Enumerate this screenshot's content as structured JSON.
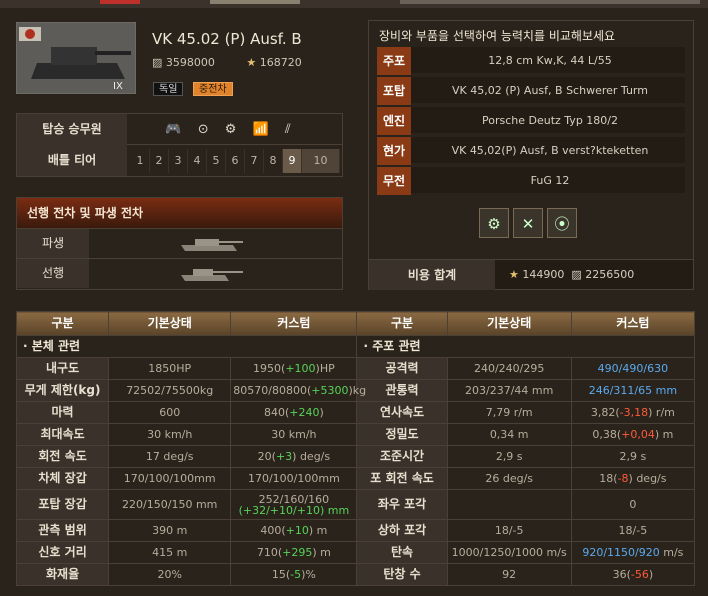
{
  "tank": {
    "name": "VK 45.02 (P) Ausf. B",
    "silver": "3598000",
    "gold": "168720",
    "tier_label": "IX",
    "badge_nation": "독일",
    "badge_class": "중전차"
  },
  "crew": {
    "label": "탑승 승무원",
    "icons": "🎮 ⊙ ⚙ 📶 ⫽"
  },
  "tiers": {
    "label": "배틀 티어",
    "values": [
      "1",
      "2",
      "3",
      "4",
      "5",
      "6",
      "7",
      "8",
      "9",
      "10"
    ]
  },
  "related": {
    "title": "선행 전차 및 파생 전차",
    "derived": "파생",
    "previous": "선행"
  },
  "equip": {
    "title": "장비와 부품을 선택하여 능력치를 비교해보세요",
    "rows": [
      {
        "label": "주포",
        "value": "12,8 cm Kw,K, 44 L/55"
      },
      {
        "label": "포탑",
        "value": "VK 45,02 (P) Ausf, B Schwerer Turm"
      },
      {
        "label": "엔진",
        "value": "Porsche Deutz Typ 180/2"
      },
      {
        "label": "현가",
        "value": "VK 45,02(P) Ausf, B verst?kteketten"
      },
      {
        "label": "무전",
        "value": "FuG 12"
      }
    ],
    "cost_label": "비용 합계",
    "cost_gold": "144900",
    "cost_silver": "2256500"
  },
  "headers": [
    "구분",
    "기본상태",
    "커스텀",
    "구분",
    "기본상태",
    "커스텀"
  ],
  "sections": {
    "left": "본체 관련",
    "right": "주포 관련"
  },
  "rows": [
    {
      "l": "내구도",
      "lb": "1850HP",
      "lc": [
        "1950(",
        "+100",
        ")HP"
      ],
      "lcc": "g",
      "r": "공격력",
      "rb": "240/240/295",
      "rc": [
        "490/490/630",
        "",
        ""
      ],
      "rcc": "b"
    },
    {
      "l": "무게 제한(kg)",
      "lb": "72502/75500kg",
      "lc": [
        "80570/80800(",
        "+5300",
        ")kg"
      ],
      "lcc": "g",
      "r": "관통력",
      "rb": "203/237/44 mm",
      "rc": [
        "246/311/65 mm",
        "",
        ""
      ],
      "rcc": "b"
    },
    {
      "l": "마력",
      "lb": "600",
      "lc": [
        "840(",
        "+240",
        ")"
      ],
      "lcc": "g",
      "r": "연사속도",
      "rb": "7,79 r/m",
      "rc": [
        "3,82(",
        "-3,18",
        ") r/m"
      ],
      "rcc": "r"
    },
    {
      "l": "최대속도",
      "lb": "30 km/h",
      "lc": [
        "30 km/h",
        "",
        ""
      ],
      "lcc": "g",
      "r": "정밀도",
      "rb": "0,34 m",
      "rc": [
        "0,38(",
        "+0,04",
        ") m"
      ],
      "rcc": "r"
    },
    {
      "l": "회전 속도",
      "lb": "17 deg/s",
      "lc": [
        "20(",
        "+3",
        ") deg/s"
      ],
      "lcc": "g",
      "r": "조준시간",
      "rb": "2,9 s",
      "rc": [
        "2,9 s",
        "",
        ""
      ],
      "rcc": "w"
    },
    {
      "l": "차체 장갑",
      "lb": "170/100/100mm",
      "lc": [
        "170/100/100mm",
        "",
        ""
      ],
      "lcc": "g",
      "r": "포 회전 속도",
      "rb": "26 deg/s",
      "rc": [
        "18(",
        "-8",
        ") deg/s"
      ],
      "rcc": "r"
    }
  ],
  "turret_row": {
    "l": "포탑 장갑",
    "lb": "220/150/150 mm",
    "lc1": "252/160/160",
    "lc2": "(+32/+10/+10) mm",
    "r": "좌우 포각",
    "rb": "",
    "rc": "0"
  },
  "rows2": [
    {
      "l": "관측 범위",
      "lb": "390 m",
      "lc": [
        "400(",
        "+10",
        ") m"
      ],
      "lcc": "g",
      "r": "상하 포각",
      "rb": "18/-5",
      "rc": [
        "18/-5",
        "",
        ""
      ],
      "rcc": "w"
    },
    {
      "l": "신호 거리",
      "lb": "415 m",
      "lc": [
        "710(",
        "+295",
        ") m"
      ],
      "lcc": "g",
      "r": "탄속",
      "rb": "1000/1250/1000 m/s",
      "rc": [
        "920/1150/920 m/s",
        "",
        ""
      ],
      "rcc": "bm"
    },
    {
      "l": "화재율",
      "lb": "20%",
      "lc": [
        "15(",
        "-5",
        ")%"
      ],
      "lcc": "g",
      "r": "탄창 수",
      "rb": "92",
      "rc": [
        "36(",
        "-56",
        ")"
      ],
      "rcc": "r"
    }
  ]
}
